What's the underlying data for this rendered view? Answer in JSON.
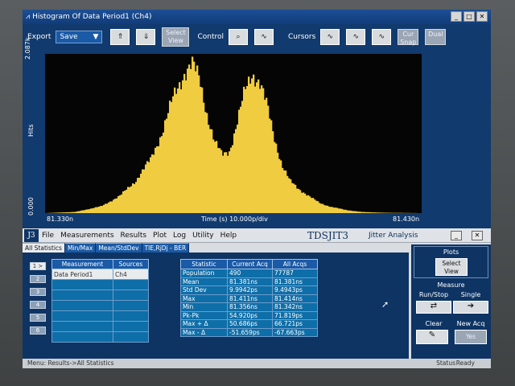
{
  "window": {
    "title": "Histogram Of Data Period1 (Ch4)",
    "min": "_",
    "max": "□",
    "close": "✕"
  },
  "toolbar": {
    "export_label": "Export",
    "export_value": "Save",
    "select_view": "Select View",
    "control_label": "Control",
    "cursors_label": "Cursors",
    "cursor_btn4": "Cur Snap",
    "cursor_btn5": "Dual"
  },
  "plot": {
    "y_max": "2.087k",
    "y_unit": "Hits",
    "y_min": "0.000",
    "x_left": "81.330n",
    "x_center": "Time (s)  10.000p/div",
    "x_right": "81.430n",
    "bar_color": "#f0cc40",
    "background": "#050505"
  },
  "chart_data": {
    "type": "bar",
    "xlabel": "Time (s)",
    "ylabel": "Hits",
    "xlim": [
      81.33,
      81.43
    ],
    "ylim": [
      0,
      2087
    ],
    "x": [
      81.33,
      81.338,
      81.345,
      81.35,
      81.354,
      81.358,
      81.361,
      81.364,
      81.367,
      81.369,
      81.371,
      81.373,
      81.375,
      81.377,
      81.379,
      81.381,
      81.383,
      81.385,
      81.387,
      81.389,
      81.391,
      81.393,
      81.395,
      81.397,
      81.399,
      81.401,
      81.403,
      81.406,
      81.41,
      81.414,
      81.42,
      81.43
    ],
    "values": [
      0,
      15,
      90,
      230,
      420,
      700,
      1050,
      1500,
      1850,
      1950,
      1750,
      1300,
      930,
      760,
      820,
      1180,
      1580,
      1840,
      1720,
      1380,
      960,
      620,
      420,
      330,
      260,
      190,
      130,
      80,
      40,
      15,
      5,
      0
    ]
  },
  "app": {
    "logo": "J3",
    "menus": [
      "File",
      "Measurements",
      "Results",
      "Plot",
      "Log",
      "Utility",
      "Help"
    ],
    "brand": "TDSJIT3",
    "brand_sub": "Jitter Analysis",
    "min_btn": "_",
    "close_btn": "✕"
  },
  "tabs": [
    "All Statistics",
    "Min/Max",
    "Mean/StdDev",
    "TIE,RjDj - BER"
  ],
  "rows": [
    "1 >",
    "2",
    "3",
    "4",
    "5",
    "6"
  ],
  "measurements": {
    "headers": [
      "Measurement",
      "Sources"
    ],
    "items": [
      [
        "Data Period1",
        "Ch4"
      ]
    ]
  },
  "statistics": {
    "headers": [
      "Statistic",
      "Current Acq",
      "All Acqs"
    ],
    "rows": [
      [
        "Population",
        "490",
        "77787"
      ],
      [
        "Mean",
        "81.381ns",
        "81.381ns"
      ],
      [
        "Std Dev",
        "9.9942ps",
        "9.4943ps"
      ],
      [
        "Max",
        "81.411ns",
        "81.414ns"
      ],
      [
        "Min",
        "81.356ns",
        "81.342ns"
      ],
      [
        "Pk-Pk",
        "54.920ps",
        "71.819ps"
      ],
      [
        "Max + Δ",
        "50.686ps",
        "66.721ps"
      ],
      [
        "Max - Δ",
        "-51.659ps",
        "-67.663ps"
      ]
    ]
  },
  "side": {
    "plots": "Plots",
    "select_view": "Select View",
    "measure": "Measure",
    "run_stop": "Run/Stop",
    "single": "Single",
    "clear": "Clear",
    "new_acq": "New Acq",
    "yes": "Yes"
  },
  "status": {
    "menu_path": "Menu: Results->All Statistics",
    "status_label": "Status",
    "status_value": "Ready"
  }
}
